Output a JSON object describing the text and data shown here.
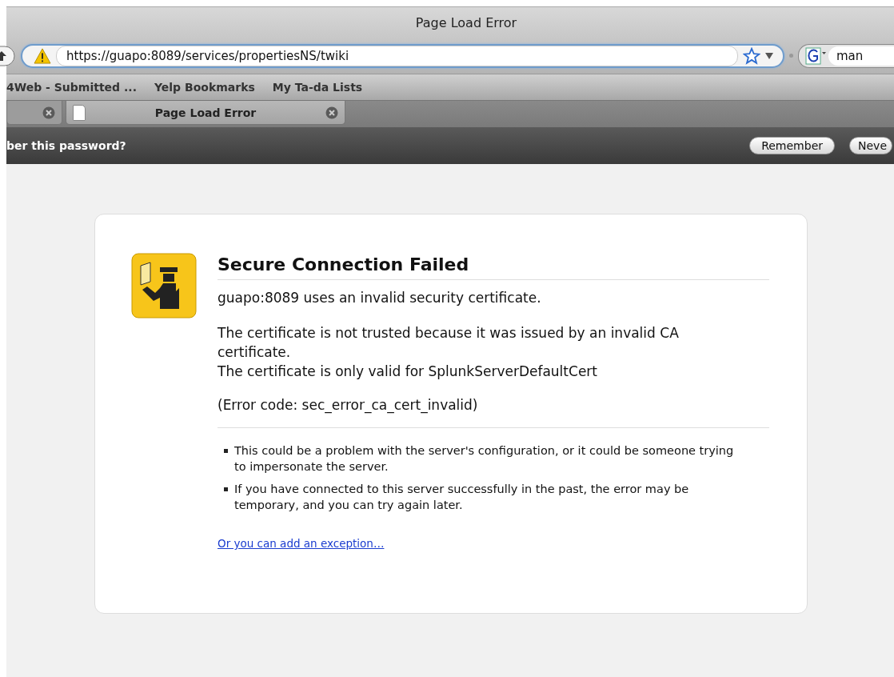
{
  "window": {
    "title": "Page Load Error"
  },
  "toolbar": {
    "url": "https://guapo:8089/services/propertiesNS/twiki",
    "search_value": "man"
  },
  "bookmarks": [
    "4Web - Submitted ...",
    "Yelp Bookmarks",
    "My Ta-da Lists"
  ],
  "tabs": [
    {
      "selected": false
    },
    {
      "label": "Page Load Error",
      "selected": true
    }
  ],
  "password_bar": {
    "prompt": "ber this password?",
    "buttons": [
      "Remember",
      "Neve"
    ]
  },
  "error": {
    "title": "Secure Connection Failed",
    "message": "guapo:8089 uses an invalid security certificate.",
    "details": [
      "The certificate is not trusted because it was issued by an invalid CA certificate.",
      "The certificate is only valid for SplunkServerDefaultCert"
    ],
    "error_code": "(Error code: sec_error_ca_cert_invalid)",
    "bullets": [
      "This could be a problem with the server's configuration, or it could be someone trying to impersonate the server.",
      "If you have connected to this server successfully in the past, the error may be temporary, and you can try again later."
    ],
    "link": "Or you can add an exception…"
  }
}
